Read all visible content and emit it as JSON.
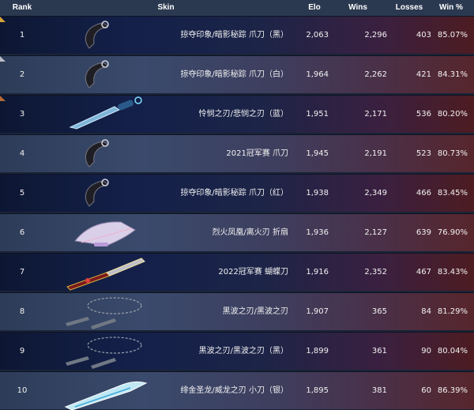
{
  "header": {
    "rank": "Rank",
    "skin": "Skin",
    "elo": "Elo",
    "wins": "Wins",
    "losses": "Losses",
    "win_pct": "Win %"
  },
  "rows": [
    {
      "rank": "1",
      "skin": "掠夺印象/暗影秘踪 爪刀（黑）",
      "elo": "2,063",
      "wins": "2,296",
      "losses": "403",
      "win_pct": "85.07%",
      "medal_color": "#d9a43a",
      "icon": "karambit-knife-black-icon"
    },
    {
      "rank": "2",
      "skin": "掠夺印象/暗影秘踪 爪刀（白）",
      "elo": "1,964",
      "wins": "2,262",
      "losses": "421",
      "win_pct": "84.31%",
      "medal_color": "#b8bcc6",
      "icon": "karambit-knife-white-icon"
    },
    {
      "rank": "3",
      "skin": "怜悯之刃/悲悯之刃（蓝）",
      "elo": "1,951",
      "wins": "2,171",
      "losses": "536",
      "win_pct": "80.20%",
      "medal_color": "#b46a33",
      "icon": "dagger-blue-icon"
    },
    {
      "rank": "4",
      "skin": "2021冠军赛 爪刀",
      "elo": "1,945",
      "wins": "2,191",
      "losses": "523",
      "win_pct": "80.73%",
      "icon": "karambit-knife-gold-icon"
    },
    {
      "rank": "5",
      "skin": "掠夺印象/暗影秘踪 爪刀（红）",
      "elo": "1,938",
      "wins": "2,349",
      "losses": "466",
      "win_pct": "83.45%",
      "icon": "karambit-knife-red-icon"
    },
    {
      "rank": "6",
      "skin": "烈火凤凰/离火刃 折扇",
      "elo": "1,936",
      "wins": "2,127",
      "losses": "639",
      "win_pct": "76.90%",
      "icon": "folding-fan-icon"
    },
    {
      "rank": "7",
      "skin": "2022冠军赛 蝴蝶刀",
      "elo": "1,916",
      "wins": "2,352",
      "losses": "467",
      "win_pct": "83.43%",
      "icon": "butterfly-knife-icon"
    },
    {
      "rank": "8",
      "skin": "黑波之刃/黑波之刃",
      "elo": "1,907",
      "wins": "365",
      "losses": "84",
      "win_pct": "81.29%",
      "icon": "kunai-chain-icon"
    },
    {
      "rank": "9",
      "skin": "黑波之刃/黑波之刃（黑）",
      "elo": "1,899",
      "wins": "361",
      "losses": "90",
      "win_pct": "80.04%",
      "icon": "kunai-chain-black-icon"
    },
    {
      "rank": "10",
      "skin": "绯金圣龙/威龙之刃 小刀（银）",
      "elo": "1,895",
      "wins": "381",
      "losses": "60",
      "win_pct": "86.39%",
      "icon": "dragon-knife-silver-icon"
    }
  ]
}
